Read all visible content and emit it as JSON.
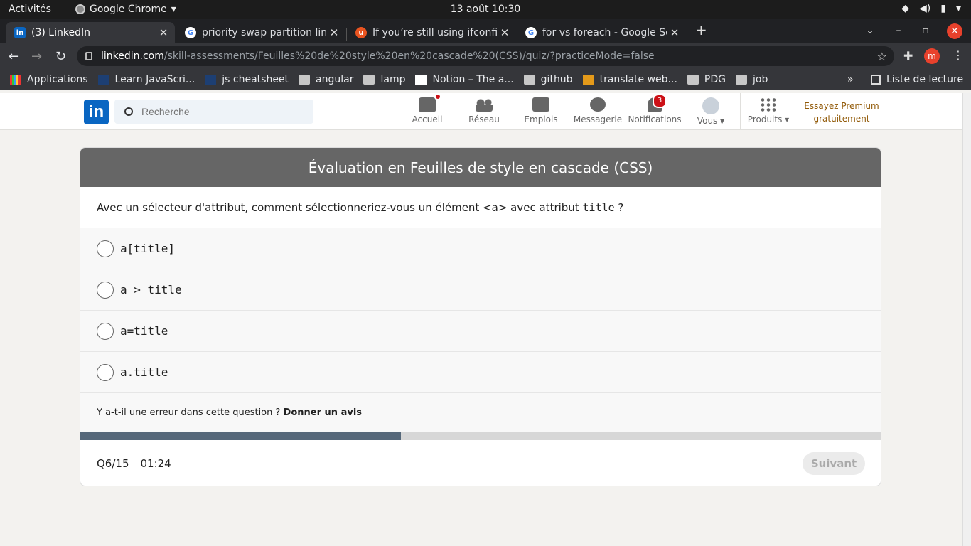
{
  "os_bar": {
    "activities": "Activités",
    "app_name": "Google Chrome",
    "clock": "13 août  10:30"
  },
  "tabs": [
    {
      "title": "(3) LinkedIn",
      "favicon": "linkedin-icon"
    },
    {
      "title": "priority swap partition lin",
      "favicon": "google-icon"
    },
    {
      "title": "If you’re still using ifconfi",
      "favicon": "ubuntu-icon"
    },
    {
      "title": "for vs foreach - Google Se",
      "favicon": "google-icon"
    }
  ],
  "address_bar": {
    "host": "linkedin.com",
    "path": "/skill-assessments/Feuilles%20de%20style%20en%20cascade%20(CSS)/quiz/?practiceMode=false"
  },
  "profile_initial": "m",
  "bookmarks": [
    {
      "label": "Applications",
      "icon": "apps-grid-icon"
    },
    {
      "label": "Learn JavaScri...",
      "icon": "page-icon"
    },
    {
      "label": "js cheatsheet",
      "icon": "page-icon"
    },
    {
      "label": "angular",
      "icon": "folder-icon"
    },
    {
      "label": "lamp",
      "icon": "folder-icon"
    },
    {
      "label": "Notion – The a...",
      "icon": "notion-icon"
    },
    {
      "label": "github",
      "icon": "folder-icon"
    },
    {
      "label": "translate web...",
      "icon": "translate-icon"
    },
    {
      "label": "PDG",
      "icon": "folder-icon"
    },
    {
      "label": "job",
      "icon": "folder-icon"
    }
  ],
  "bookmarks_more": "»",
  "reading_list": "Liste de lecture",
  "linkedin": {
    "logo": "in",
    "search_placeholder": "Recherche",
    "nav": [
      {
        "label": "Accueil",
        "badge": ""
      },
      {
        "label": "Réseau",
        "badge": ""
      },
      {
        "label": "Emplois",
        "badge": ""
      },
      {
        "label": "Messagerie",
        "badge": ""
      },
      {
        "label": "Notifications",
        "badge": "3"
      },
      {
        "label": "Vous ▾",
        "badge": ""
      },
      {
        "label": "Produits ▾",
        "badge": ""
      }
    ],
    "premium": "Essayez Premium gratuitement"
  },
  "quiz": {
    "title": "Évaluation en Feuilles de style en cascade (CSS)",
    "question_prefix": "Avec un sélecteur d'attribut, comment sélectionneriez-vous un élément <a> avec attribut ",
    "question_code": "title",
    "question_suffix": " ?",
    "options": [
      "a[title]",
      "a > title",
      "a=title",
      "a.title"
    ],
    "feedback_text": "Y a-t-il une erreur dans cette question ? ",
    "feedback_link": "Donner un avis",
    "progress": 0.4,
    "counter": "Q6/15",
    "timer": "01:24",
    "next_label": "Suivant"
  }
}
